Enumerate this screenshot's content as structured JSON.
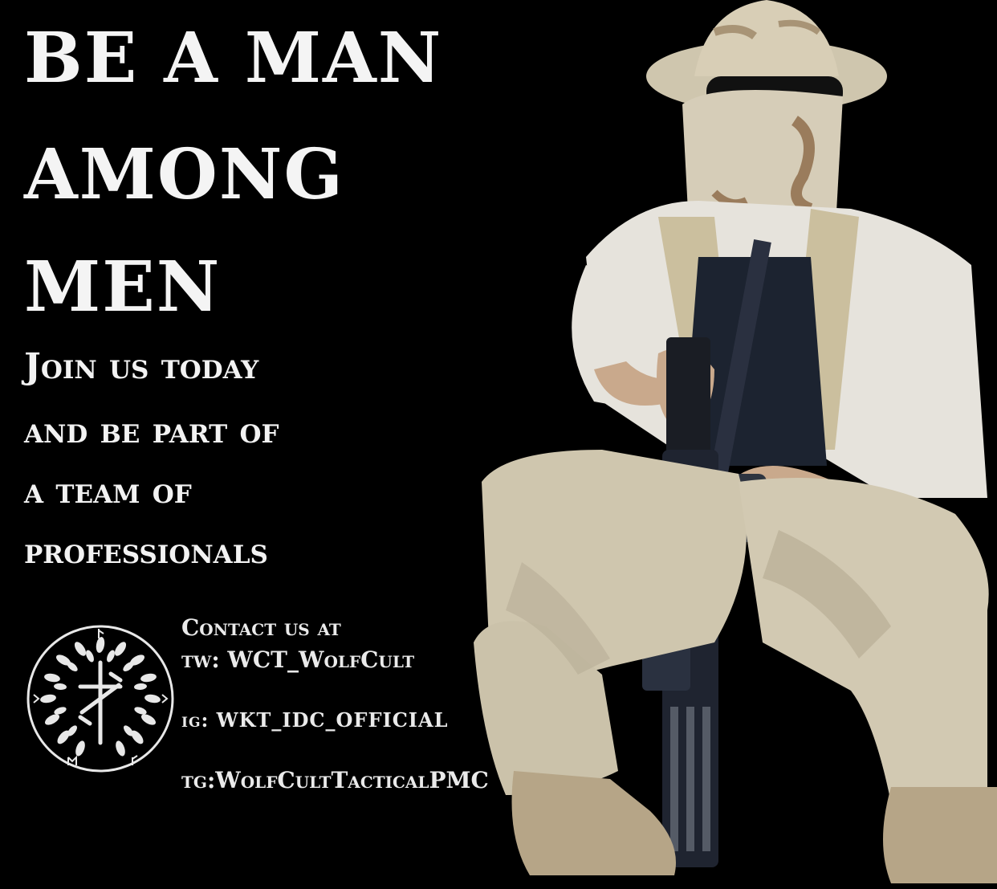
{
  "poster": {
    "headline": [
      "BE A MAN",
      "AMONG",
      "MEN"
    ],
    "subheadline": [
      "Join us today",
      "and be part of",
      "a team of",
      "professionals"
    ],
    "contact": {
      "intro": "Contact us at",
      "tw": "tw: WCT_WolfCult",
      "ig": "ig: WKT_IDC_OFFICIAL",
      "tg": "tg:WolfCultTacticalPMC"
    }
  },
  "colors": {
    "background": "#000000",
    "text": "#f4f4f4"
  },
  "icons": {
    "emblem": "wreath-crossed-blades-emblem-icon"
  }
}
